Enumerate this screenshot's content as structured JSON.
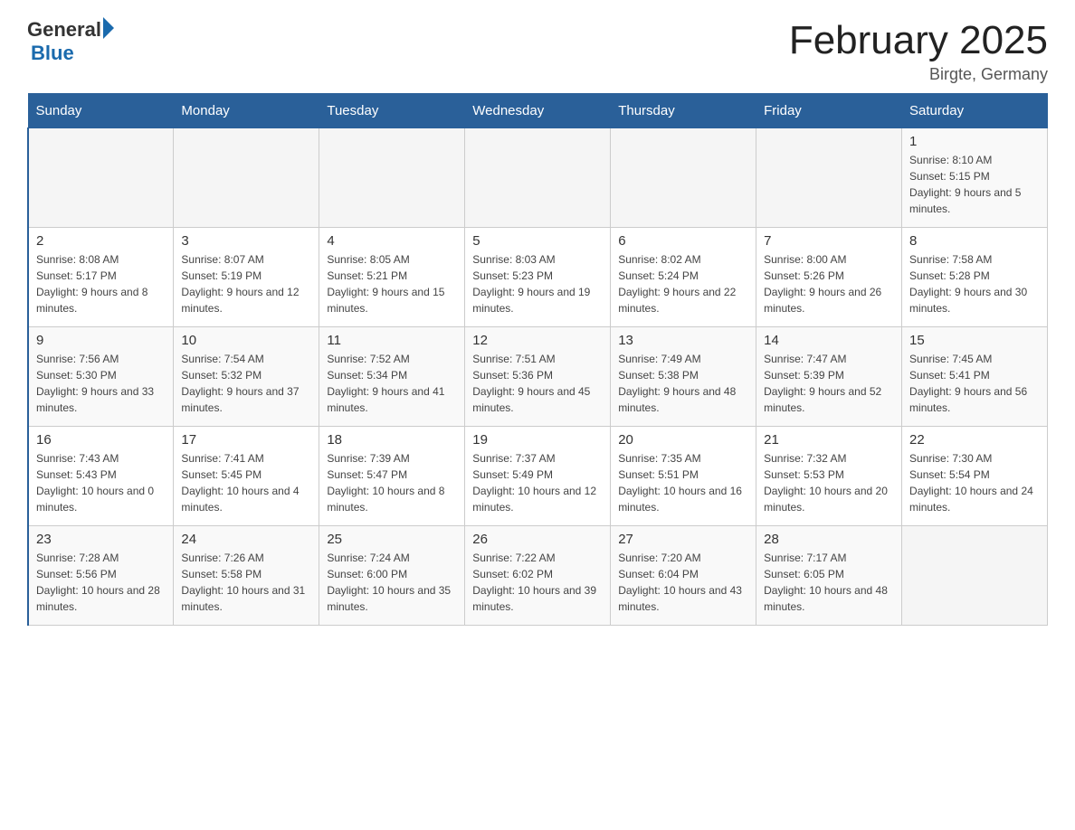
{
  "header": {
    "logo": {
      "general": "General",
      "blue": "Blue"
    },
    "title": "February 2025",
    "location": "Birgte, Germany"
  },
  "days_of_week": [
    "Sunday",
    "Monday",
    "Tuesday",
    "Wednesday",
    "Thursday",
    "Friday",
    "Saturday"
  ],
  "weeks": [
    [
      {
        "day": "",
        "info": ""
      },
      {
        "day": "",
        "info": ""
      },
      {
        "day": "",
        "info": ""
      },
      {
        "day": "",
        "info": ""
      },
      {
        "day": "",
        "info": ""
      },
      {
        "day": "",
        "info": ""
      },
      {
        "day": "1",
        "info": "Sunrise: 8:10 AM\nSunset: 5:15 PM\nDaylight: 9 hours and 5 minutes."
      }
    ],
    [
      {
        "day": "2",
        "info": "Sunrise: 8:08 AM\nSunset: 5:17 PM\nDaylight: 9 hours and 8 minutes."
      },
      {
        "day": "3",
        "info": "Sunrise: 8:07 AM\nSunset: 5:19 PM\nDaylight: 9 hours and 12 minutes."
      },
      {
        "day": "4",
        "info": "Sunrise: 8:05 AM\nSunset: 5:21 PM\nDaylight: 9 hours and 15 minutes."
      },
      {
        "day": "5",
        "info": "Sunrise: 8:03 AM\nSunset: 5:23 PM\nDaylight: 9 hours and 19 minutes."
      },
      {
        "day": "6",
        "info": "Sunrise: 8:02 AM\nSunset: 5:24 PM\nDaylight: 9 hours and 22 minutes."
      },
      {
        "day": "7",
        "info": "Sunrise: 8:00 AM\nSunset: 5:26 PM\nDaylight: 9 hours and 26 minutes."
      },
      {
        "day": "8",
        "info": "Sunrise: 7:58 AM\nSunset: 5:28 PM\nDaylight: 9 hours and 30 minutes."
      }
    ],
    [
      {
        "day": "9",
        "info": "Sunrise: 7:56 AM\nSunset: 5:30 PM\nDaylight: 9 hours and 33 minutes."
      },
      {
        "day": "10",
        "info": "Sunrise: 7:54 AM\nSunset: 5:32 PM\nDaylight: 9 hours and 37 minutes."
      },
      {
        "day": "11",
        "info": "Sunrise: 7:52 AM\nSunset: 5:34 PM\nDaylight: 9 hours and 41 minutes."
      },
      {
        "day": "12",
        "info": "Sunrise: 7:51 AM\nSunset: 5:36 PM\nDaylight: 9 hours and 45 minutes."
      },
      {
        "day": "13",
        "info": "Sunrise: 7:49 AM\nSunset: 5:38 PM\nDaylight: 9 hours and 48 minutes."
      },
      {
        "day": "14",
        "info": "Sunrise: 7:47 AM\nSunset: 5:39 PM\nDaylight: 9 hours and 52 minutes."
      },
      {
        "day": "15",
        "info": "Sunrise: 7:45 AM\nSunset: 5:41 PM\nDaylight: 9 hours and 56 minutes."
      }
    ],
    [
      {
        "day": "16",
        "info": "Sunrise: 7:43 AM\nSunset: 5:43 PM\nDaylight: 10 hours and 0 minutes."
      },
      {
        "day": "17",
        "info": "Sunrise: 7:41 AM\nSunset: 5:45 PM\nDaylight: 10 hours and 4 minutes."
      },
      {
        "day": "18",
        "info": "Sunrise: 7:39 AM\nSunset: 5:47 PM\nDaylight: 10 hours and 8 minutes."
      },
      {
        "day": "19",
        "info": "Sunrise: 7:37 AM\nSunset: 5:49 PM\nDaylight: 10 hours and 12 minutes."
      },
      {
        "day": "20",
        "info": "Sunrise: 7:35 AM\nSunset: 5:51 PM\nDaylight: 10 hours and 16 minutes."
      },
      {
        "day": "21",
        "info": "Sunrise: 7:32 AM\nSunset: 5:53 PM\nDaylight: 10 hours and 20 minutes."
      },
      {
        "day": "22",
        "info": "Sunrise: 7:30 AM\nSunset: 5:54 PM\nDaylight: 10 hours and 24 minutes."
      }
    ],
    [
      {
        "day": "23",
        "info": "Sunrise: 7:28 AM\nSunset: 5:56 PM\nDaylight: 10 hours and 28 minutes."
      },
      {
        "day": "24",
        "info": "Sunrise: 7:26 AM\nSunset: 5:58 PM\nDaylight: 10 hours and 31 minutes."
      },
      {
        "day": "25",
        "info": "Sunrise: 7:24 AM\nSunset: 6:00 PM\nDaylight: 10 hours and 35 minutes."
      },
      {
        "day": "26",
        "info": "Sunrise: 7:22 AM\nSunset: 6:02 PM\nDaylight: 10 hours and 39 minutes."
      },
      {
        "day": "27",
        "info": "Sunrise: 7:20 AM\nSunset: 6:04 PM\nDaylight: 10 hours and 43 minutes."
      },
      {
        "day": "28",
        "info": "Sunrise: 7:17 AM\nSunset: 6:05 PM\nDaylight: 10 hours and 48 minutes."
      },
      {
        "day": "",
        "info": ""
      }
    ]
  ]
}
